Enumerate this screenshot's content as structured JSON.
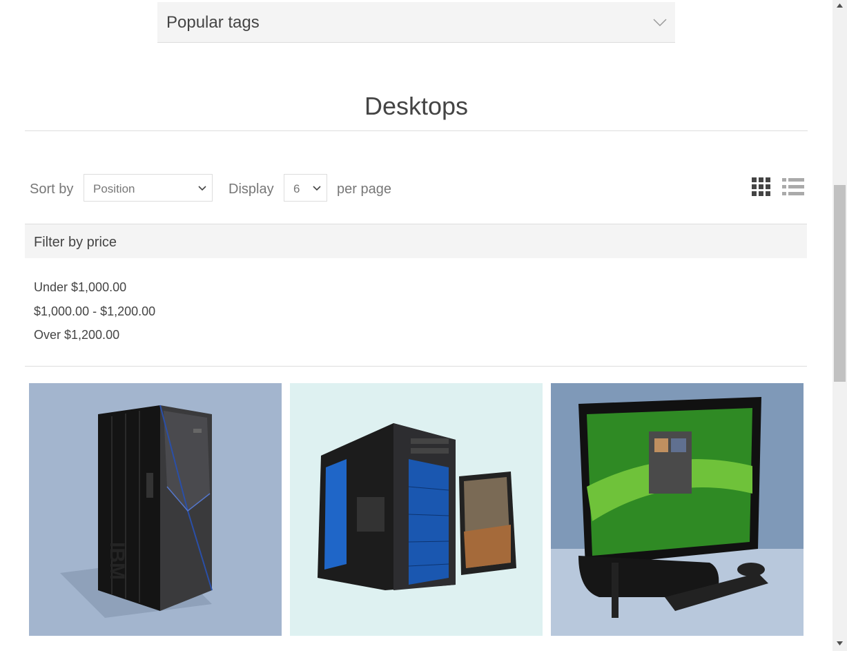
{
  "popular_tags": {
    "title": "Popular tags"
  },
  "page_title": "Desktops",
  "toolbar": {
    "sort_label": "Sort by",
    "sort_value": "Position",
    "display_label": "Display",
    "display_value": "6",
    "per_page_label": "per page",
    "view_modes": [
      "grid-icon",
      "list-icon"
    ],
    "active_view": "grid"
  },
  "filter": {
    "title": "Filter by price",
    "options": [
      "Under $1,000.00",
      "$1,000.00 - $1,200.00",
      "Over $1,200.00"
    ]
  },
  "products": [
    {
      "image": "ibm-enterprise-server-image",
      "bg": "#a3b5ce"
    },
    {
      "image": "gaming-desktop-tower-image",
      "bg": "#def1f1"
    },
    {
      "image": "lenovo-all-in-one-pc-image",
      "bg": "#7f99b8"
    }
  ],
  "colors": {
    "text": "#444444",
    "muted": "#777777",
    "panel": "#f4f4f4",
    "border": "#dddddd"
  }
}
